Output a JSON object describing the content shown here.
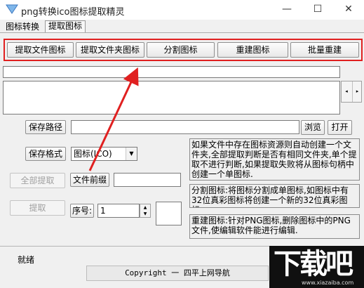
{
  "window": {
    "title": "png转换ico图标提取精灵",
    "minimize": "—",
    "maximize": "☐",
    "close": "✕"
  },
  "tabs": [
    {
      "label": "图标转换",
      "active": false
    },
    {
      "label": "提取图标",
      "active": true
    }
  ],
  "toolbar": [
    {
      "label": "提取文件图标"
    },
    {
      "label": "提取文件夹图标"
    },
    {
      "label": "分割图标"
    },
    {
      "label": "重建图标"
    },
    {
      "label": "批量重建"
    }
  ],
  "hspin": {
    "left": "◂",
    "right": "▸"
  },
  "save_path": {
    "label": "保存路径",
    "value": "",
    "browse": "浏览",
    "open": "打开"
  },
  "save_format": {
    "label": "保存格式",
    "value": "图标(ICO)",
    "arrow": "▼"
  },
  "extract_all": {
    "label": "全部提取",
    "disabled": true
  },
  "file_prefix": {
    "label": "文件前缀",
    "value": ""
  },
  "extract": {
    "label": "提取",
    "disabled": true
  },
  "sequence": {
    "label": "序号:",
    "value": "1",
    "up": "▲",
    "down": "▼"
  },
  "info": {
    "extract": "如果文件中存在图标资源则自动创建一个文件夹,全部提取判断是否有相同文件夹,单个提取不进行判断,如果提取失败将从图标句柄中创建一个单图标.",
    "split": "分割图标:将图标分割成单图标,如图标中有32位真彩图标将创建一个新的32位真彩图标.",
    "rebuild": "重建图标:针对PNG图标,删除图标中的PNG文件,使编辑软件能进行编辑."
  },
  "status": {
    "text": "就绪"
  },
  "copyright": "Copyright 一 四平上网导航",
  "watermark": {
    "mark": "下载吧",
    "url": "www.xiazaiba.com"
  },
  "colors": {
    "highlight": "#e02020",
    "background": "#f0f0f0"
  }
}
